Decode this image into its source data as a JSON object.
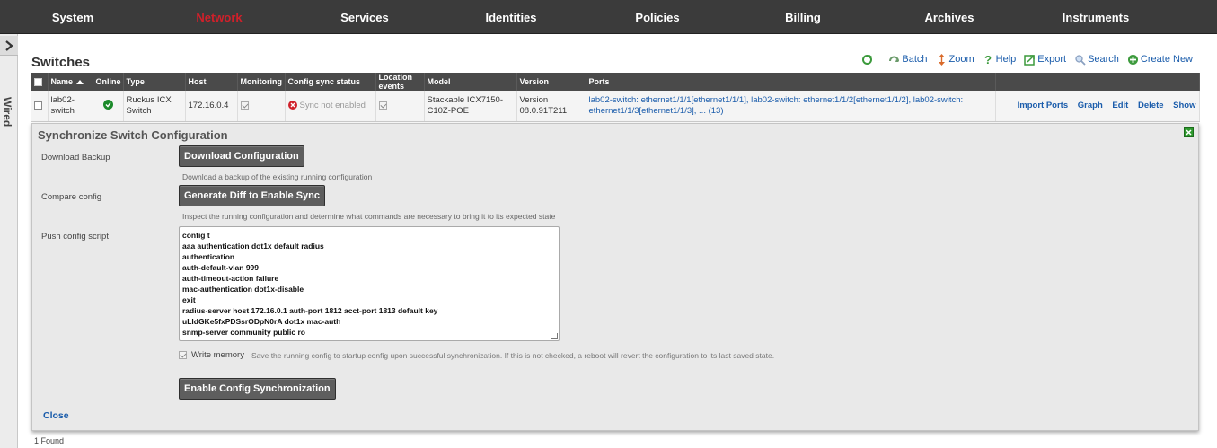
{
  "topnav": {
    "items": [
      {
        "label": "System"
      },
      {
        "label": "Network"
      },
      {
        "label": "Services"
      },
      {
        "label": "Identities"
      },
      {
        "label": "Policies"
      },
      {
        "label": "Billing"
      },
      {
        "label": "Archives"
      },
      {
        "label": "Instruments"
      }
    ],
    "active": "Network",
    "active_color": "#d0202a"
  },
  "side": {
    "label": "Wired"
  },
  "page": {
    "title": "Switches",
    "found": "1 Found"
  },
  "toolbar": {
    "batch": "Batch",
    "zoom": "Zoom",
    "help": "Help",
    "export": "Export",
    "search": "Search",
    "create_new": "Create New"
  },
  "table": {
    "headers": {
      "name": "Name",
      "online": "Online",
      "type": "Type",
      "host": "Host",
      "monitoring": "Monitoring",
      "config_sync_status": "Config sync status",
      "location_events": "Location events",
      "model": "Model",
      "version": "Version",
      "ports": "Ports"
    },
    "rows": [
      {
        "name": "lab02-switch",
        "online": "ok-icon",
        "type": "Ruckus ICX Switch",
        "host": "172.16.0.4",
        "monitoring_checked": true,
        "config_sync_status": "Sync not enabled",
        "location_events_checked": true,
        "model": "Stackable ICX7150-C10Z-POE",
        "version": "Version 08.0.91T211",
        "ports": "lab02-switch: ethernet1/1/1[ethernet1/1/1], lab02-switch: ethernet1/1/2[ethernet1/1/2], lab02-switch: ethernet1/1/3[ethernet1/1/3], ... (13)",
        "actions": {
          "import_ports": "Import Ports",
          "graph": "Graph",
          "edit": "Edit",
          "delete": "Delete",
          "show": "Show"
        }
      }
    ]
  },
  "sync": {
    "title": "Synchronize Switch Configuration",
    "download_label": "Download Backup",
    "download_button": "Download Configuration",
    "download_help": "Download a backup of the existing running configuration",
    "compare_label": "Compare config",
    "compare_button": "Generate Diff to Enable Sync",
    "compare_help": "Inspect the running configuration and determine what commands are necessary to bring it to its expected state",
    "push_label": "Push config script",
    "script_lines": [
      "config t",
      "aaa authentication dot1x default radius",
      "authentication",
      "auth-default-vlan 999",
      "auth-timeout-action failure",
      "mac-authentication dot1x-disable",
      "exit",
      "radius-server host 172.16.0.1 auth-port 1812 acct-port 1813 default key",
      "uLldGKe5fxPDSsrODpN0rA dot1x mac-auth",
      "snmp-server community public ro"
    ],
    "write_memory_label": "Write memory",
    "write_memory_checked": true,
    "write_memory_help": "Save the running config to startup config upon successful synchronization. If this is not checked, a reboot will revert the configuration to its last saved state.",
    "enable_button": "Enable Config Synchronization",
    "close_link": "Close"
  },
  "colors": {
    "nav_bg": "#3b3b3b",
    "link": "#1a5cab",
    "ok": "#1b8a2a",
    "error": "#d0202a"
  }
}
